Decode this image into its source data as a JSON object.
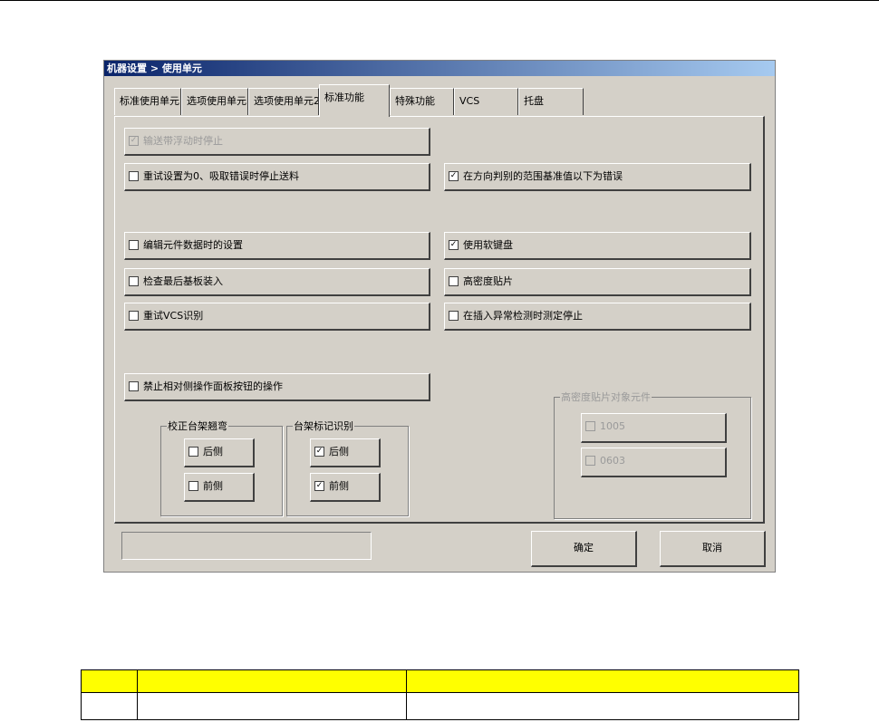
{
  "window": {
    "title": "机器设置 > 使用单元"
  },
  "tabs": [
    "标准使用单元",
    "选项使用单元",
    "选项使用单元2",
    "标准功能",
    "特殊功能",
    "VCS",
    "托盘"
  ],
  "active_tab": 3,
  "options": {
    "conveyor_stop": {
      "label": "输送带浮动时停止",
      "checked": true,
      "enabled": false
    },
    "retry_zero": {
      "label": "重试设置为0、吸取错误时停止送料",
      "checked": false
    },
    "direction_error": {
      "label": "在方向判别的范围基准值以下为错误",
      "checked": true
    },
    "edit_component": {
      "label": "编辑元件数据时的设置",
      "checked": false
    },
    "soft_keyboard": {
      "label": "使用软键盘",
      "checked": true
    },
    "check_last_board": {
      "label": "检查最后基板装入",
      "checked": false
    },
    "high_density": {
      "label": "高密度贴片",
      "checked": false
    },
    "retry_vcs": {
      "label": "重试VCS识别",
      "checked": false
    },
    "insert_abnormal": {
      "label": "在插入异常检测时测定停止",
      "checked": false
    },
    "forbid_opposite": {
      "label": "禁止相对侧操作面板按钮的操作",
      "checked": false
    }
  },
  "group_warp": {
    "title": "校正台架翘弯",
    "rear": {
      "label": "后侧",
      "checked": false
    },
    "front": {
      "label": "前侧",
      "checked": false
    }
  },
  "group_mark": {
    "title": "台架标记识别",
    "rear": {
      "label": "后侧",
      "checked": true
    },
    "front": {
      "label": "前侧",
      "checked": true
    }
  },
  "group_hd": {
    "title": "高密度贴片对象元件",
    "c1005": {
      "label": "1005",
      "checked": false
    },
    "c0603": {
      "label": "0603",
      "checked": false
    }
  },
  "buttons": {
    "ok": "确定",
    "cancel": "取消"
  },
  "check_mark": "✓",
  "status_text": ""
}
